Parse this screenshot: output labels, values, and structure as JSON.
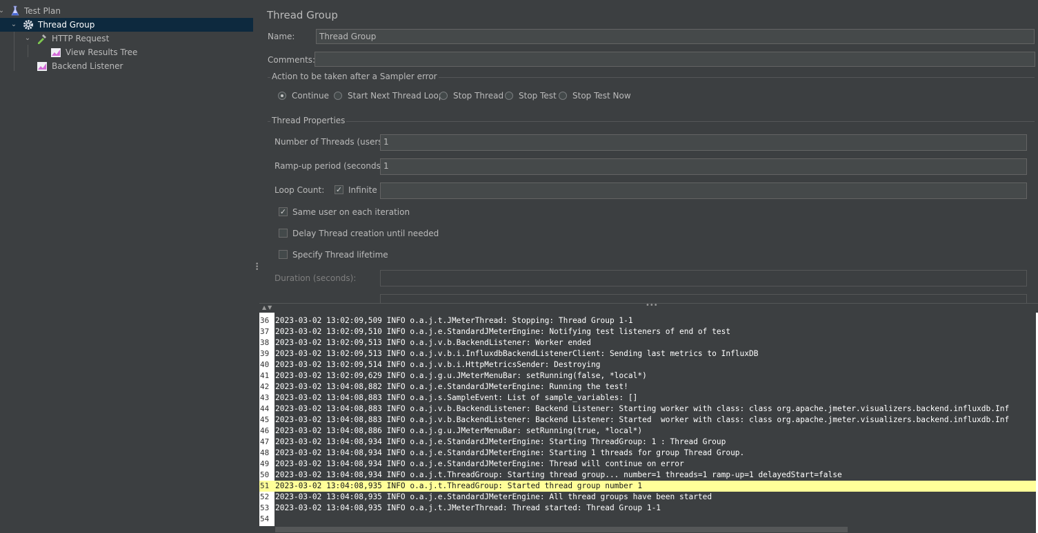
{
  "tree": {
    "items": [
      {
        "label": "Test Plan",
        "icon": "flask-icon"
      },
      {
        "label": "Thread Group",
        "icon": "gear-icon"
      },
      {
        "label": "HTTP Request",
        "icon": "pipette-icon"
      },
      {
        "label": "View Results Tree",
        "icon": "chart-icon"
      },
      {
        "label": "Backend Listener",
        "icon": "chart-icon"
      }
    ]
  },
  "panel": {
    "title": "Thread Group",
    "name_label": "Name:",
    "name_value": "Thread Group",
    "comments_label": "Comments:",
    "comments_value": "",
    "sampler_error": {
      "title": "Action to be taken after a Sampler error",
      "options": [
        "Continue",
        "Start Next Thread Loop",
        "Stop Thread",
        "Stop Test",
        "Stop Test Now"
      ],
      "selected": "Continue"
    },
    "thread_props": {
      "title": "Thread Properties",
      "threads_label": "Number of Threads (users):",
      "threads_value": "1",
      "rampup_label": "Ramp-up period (seconds):",
      "rampup_value": "1",
      "loop_label": "Loop Count:",
      "infinite_label": "Infinite",
      "infinite_checked": true,
      "loop_value": "",
      "same_user_label": "Same user on each iteration",
      "same_user_checked": true,
      "delay_label": "Delay Thread creation until needed",
      "delay_checked": false,
      "lifetime_label": "Specify Thread lifetime",
      "lifetime_checked": false,
      "duration_label": "Duration (seconds):",
      "duration_value": ""
    }
  },
  "log": {
    "lines": [
      {
        "n": "36",
        "text": "2023-03-02 13:02:09,509 INFO o.a.j.t.JMeterThread: Stopping: Thread Group 1-1"
      },
      {
        "n": "37",
        "text": "2023-03-02 13:02:09,510 INFO o.a.j.e.StandardJMeterEngine: Notifying test listeners of end of test"
      },
      {
        "n": "38",
        "text": "2023-03-02 13:02:09,513 INFO o.a.j.v.b.BackendListener: Worker ended"
      },
      {
        "n": "39",
        "text": "2023-03-02 13:02:09,513 INFO o.a.j.v.b.i.InfluxdbBackendListenerClient: Sending last metrics to InfluxDB"
      },
      {
        "n": "40",
        "text": "2023-03-02 13:02:09,514 INFO o.a.j.v.b.i.HttpMetricsSender: Destroying"
      },
      {
        "n": "41",
        "text": "2023-03-02 13:02:09,629 INFO o.a.j.g.u.JMeterMenuBar: setRunning(false, *local*)"
      },
      {
        "n": "42",
        "text": "2023-03-02 13:04:08,882 INFO o.a.j.e.StandardJMeterEngine: Running the test!"
      },
      {
        "n": "43",
        "text": "2023-03-02 13:04:08,883 INFO o.a.j.s.SampleEvent: List of sample_variables: []"
      },
      {
        "n": "44",
        "text": "2023-03-02 13:04:08,883 INFO o.a.j.v.b.BackendListener: Backend Listener: Starting worker with class: class org.apache.jmeter.visualizers.backend.influxdb.Inf"
      },
      {
        "n": "45",
        "text": "2023-03-02 13:04:08,883 INFO o.a.j.v.b.BackendListener: Backend Listener: Started  worker with class: class org.apache.jmeter.visualizers.backend.influxdb.Inf"
      },
      {
        "n": "46",
        "text": "2023-03-02 13:04:08,886 INFO o.a.j.g.u.JMeterMenuBar: setRunning(true, *local*)"
      },
      {
        "n": "47",
        "text": "2023-03-02 13:04:08,934 INFO o.a.j.e.StandardJMeterEngine: Starting ThreadGroup: 1 : Thread Group"
      },
      {
        "n": "48",
        "text": "2023-03-02 13:04:08,934 INFO o.a.j.e.StandardJMeterEngine: Starting 1 threads for group Thread Group."
      },
      {
        "n": "49",
        "text": "2023-03-02 13:04:08,934 INFO o.a.j.e.StandardJMeterEngine: Thread will continue on error"
      },
      {
        "n": "50",
        "text": "2023-03-02 13:04:08,934 INFO o.a.j.t.ThreadGroup: Starting thread group... number=1 threads=1 ramp-up=1 delayedStart=false"
      },
      {
        "n": "51",
        "text": "2023-03-02 13:04:08,935 INFO o.a.j.t.ThreadGroup: Started thread group number 1",
        "highlight": true
      },
      {
        "n": "52",
        "text": "2023-03-02 13:04:08,935 INFO o.a.j.e.StandardJMeterEngine: All thread groups have been started"
      },
      {
        "n": "53",
        "text": "2023-03-02 13:04:08,935 INFO o.a.j.t.JMeterThread: Thread started: Thread Group 1-1"
      },
      {
        "n": "54",
        "text": ""
      }
    ]
  }
}
